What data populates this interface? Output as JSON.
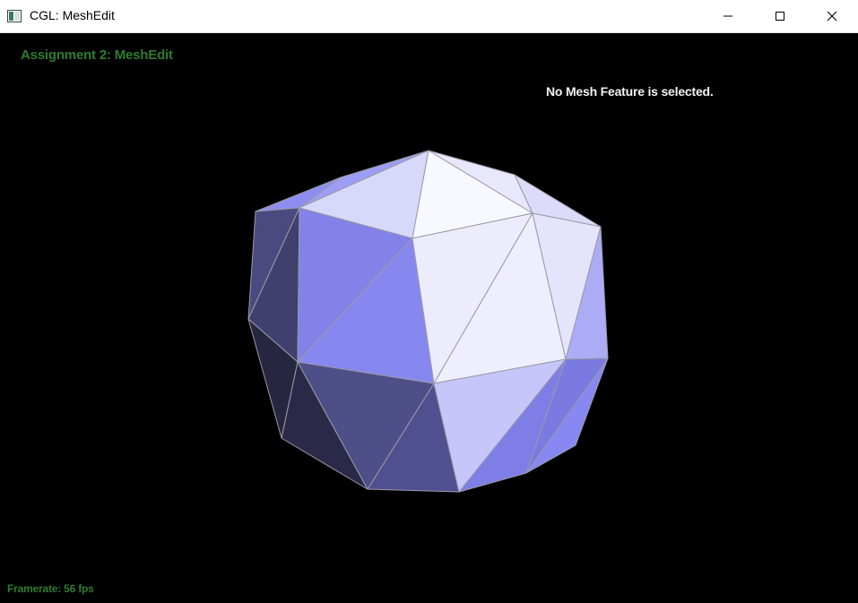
{
  "window": {
    "title": "CGL: MeshEdit",
    "icon": "app-window-icon",
    "controls": [
      "minimize-icon",
      "maximize-icon",
      "close-icon"
    ]
  },
  "hud": {
    "assignment_title": "Assignment 2: MeshEdit",
    "selection_status": "No Mesh Feature is selected.",
    "framerate": "Framerate: 56 fps"
  },
  "colors": {
    "titlebar_bg": "#ffffff",
    "viewport_bg": "#000000",
    "hud_green": "#2e7d2e",
    "mesh_edge": "#9a9aa6",
    "mesh_light": "#f8f8ff",
    "mesh_mid": "#8787f0",
    "mesh_dark": "#262640"
  }
}
